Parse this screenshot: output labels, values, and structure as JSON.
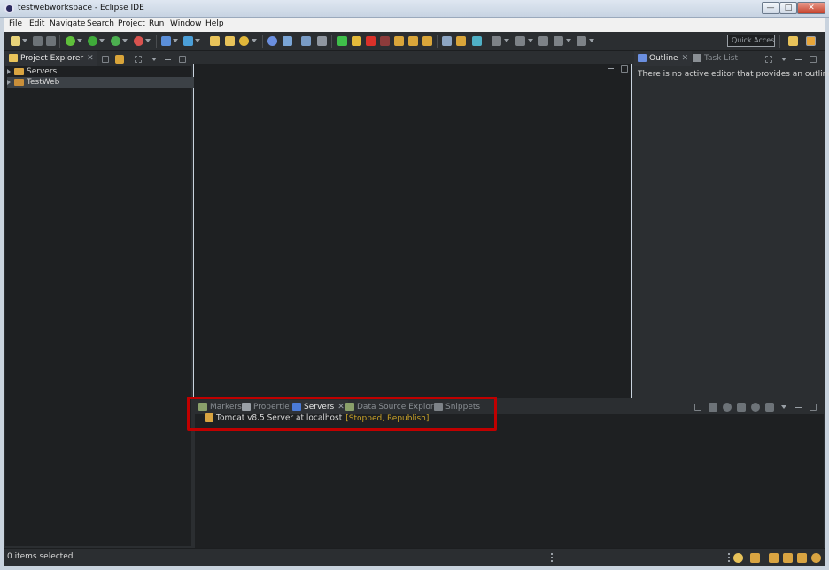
{
  "window": {
    "title": "testwebworkspace - Eclipse IDE",
    "controls": {
      "minimize": "—",
      "maximize": "□",
      "close": "✕"
    }
  },
  "menubar": {
    "items": [
      {
        "pre": "",
        "key": "F",
        "post": "ile"
      },
      {
        "pre": "",
        "key": "E",
        "post": "dit"
      },
      {
        "pre": "",
        "key": "N",
        "post": "avigate"
      },
      {
        "pre": "Se",
        "key": "a",
        "post": "rch"
      },
      {
        "pre": "",
        "key": "P",
        "post": "roject"
      },
      {
        "pre": "",
        "key": "R",
        "post": "un"
      },
      {
        "pre": "",
        "key": "W",
        "post": "indow"
      },
      {
        "pre": "",
        "key": "H",
        "post": "elp"
      }
    ]
  },
  "toolbar": {
    "quick_access": "Quick Access"
  },
  "project_explorer": {
    "tab_label": "Project Explorer",
    "items": [
      {
        "label": "Servers"
      },
      {
        "label": "TestWeb"
      }
    ]
  },
  "outline": {
    "tab_label": "Outline",
    "task_list_label": "Task List",
    "message": "There is no active editor that provides an outline."
  },
  "bottom_panel": {
    "tabs": [
      {
        "label": "Markers"
      },
      {
        "label": "Properties"
      },
      {
        "label": "Servers"
      },
      {
        "label": "Data Source Explorer"
      },
      {
        "label": "Snippets"
      }
    ],
    "server": {
      "name": "Tomcat v8.5 Server at localhost",
      "status": "[Stopped, Republish]"
    }
  },
  "statusbar": {
    "text": "0 items selected"
  },
  "colors": {
    "highlight_border": "#c00000",
    "status_accent": "#c9a227",
    "folder": "#d9a441"
  }
}
